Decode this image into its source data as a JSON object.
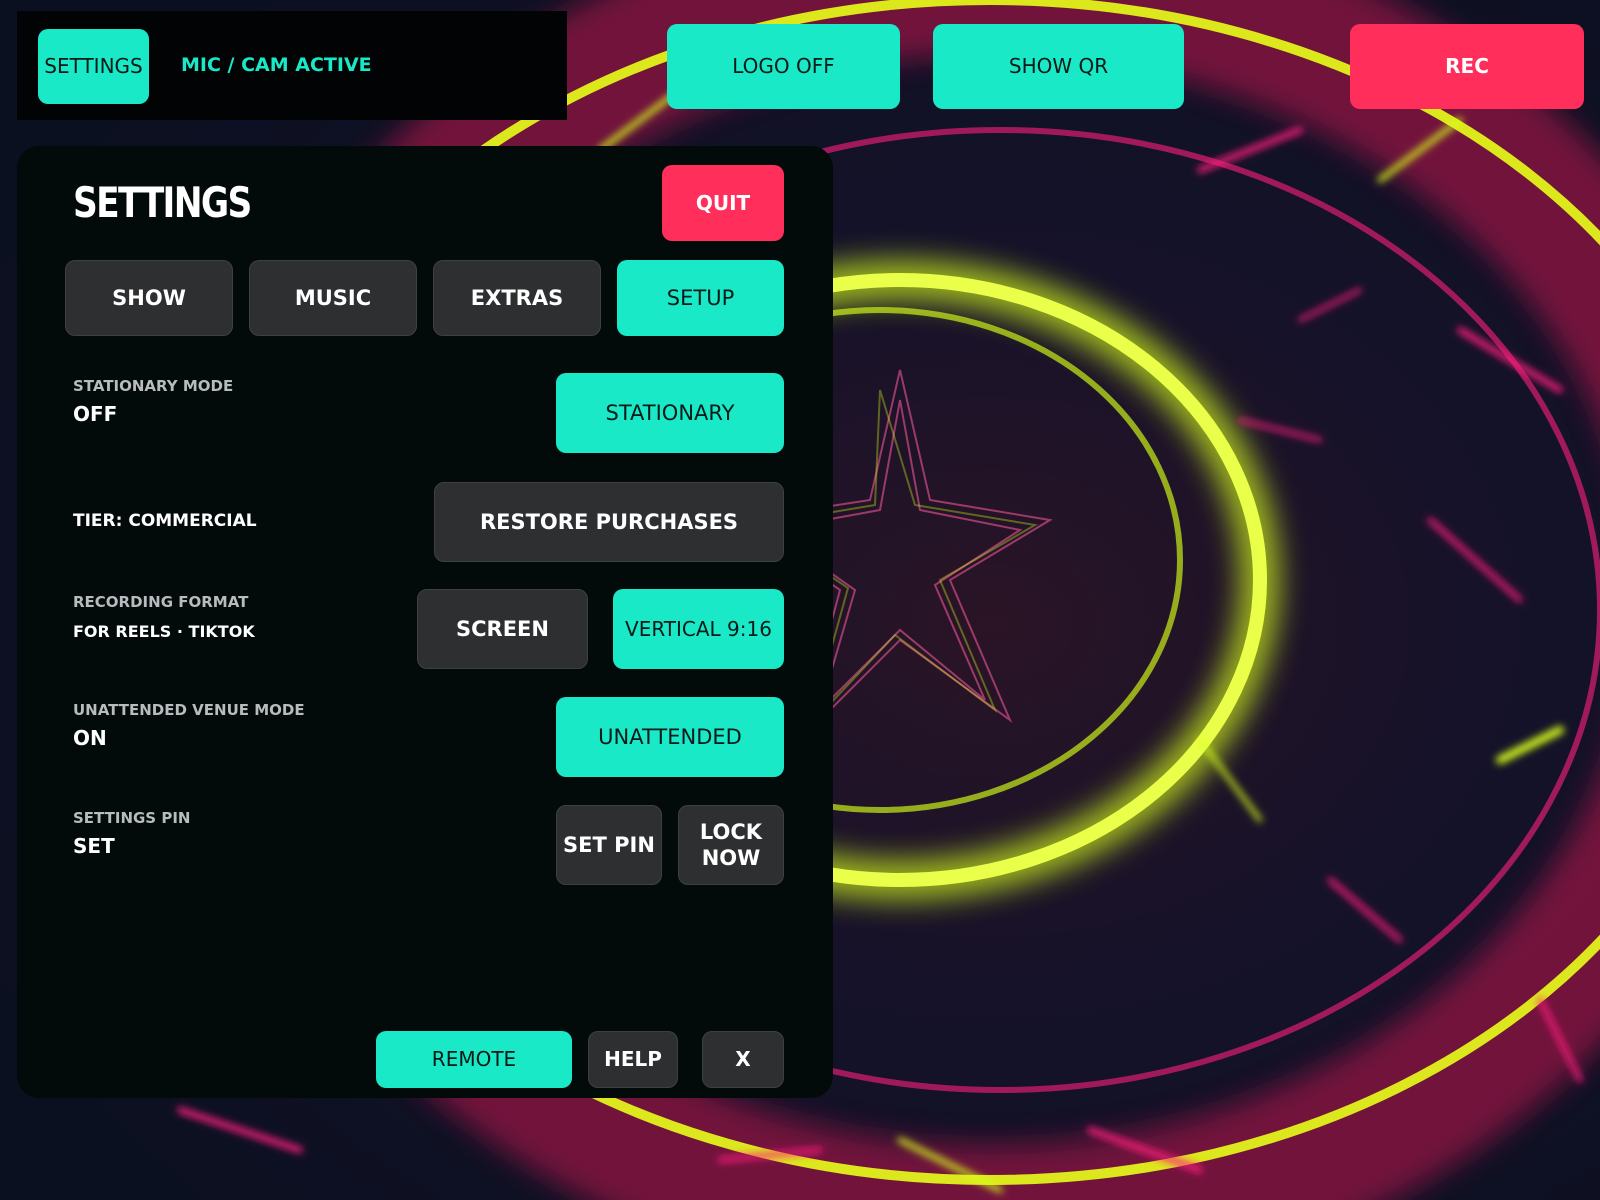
{
  "top_bar": {
    "settings_label": "SETTINGS",
    "mic_cam_status": "MIC / CAM ACTIVE",
    "logo_label": "LOGO OFF",
    "qr_label": "SHOW QR",
    "rec_label": "REC"
  },
  "panel": {
    "title": "SETTINGS",
    "quit_label": "QUIT",
    "tabs": [
      {
        "label": "SHOW",
        "active": false
      },
      {
        "label": "MUSIC",
        "active": false
      },
      {
        "label": "EXTRAS",
        "active": false
      },
      {
        "label": "SETUP",
        "active": true
      }
    ],
    "stationary": {
      "label": "STATIONARY MODE",
      "value": "OFF",
      "button": "STATIONARY"
    },
    "tier": {
      "label": "TIER: COMMERCIAL",
      "button": "RESTORE PURCHASES"
    },
    "recording": {
      "label": "RECORDING FORMAT",
      "subtitle": "FOR REELS · TIKTOK",
      "screen_button": "SCREEN",
      "vertical_button": "VERTICAL 9:16"
    },
    "unattended": {
      "label": "UNATTENDED VENUE MODE",
      "value": "ON",
      "button": "UNATTENDED"
    },
    "pin": {
      "label": "SETTINGS PIN",
      "value": "SET",
      "set_button": "SET PIN",
      "lock_button": "LOCK NOW"
    },
    "footer": {
      "remote_label": "REMOTE",
      "help_label": "HELP",
      "close_label": "X"
    }
  },
  "colors": {
    "accent": "#19e9c6",
    "danger": "#ff2e5b",
    "panel_bg": "#030a0a",
    "button_dark": "#2e2f31",
    "visual_lime": "#d8ff1a",
    "visual_pink": "#ff1f7e"
  }
}
